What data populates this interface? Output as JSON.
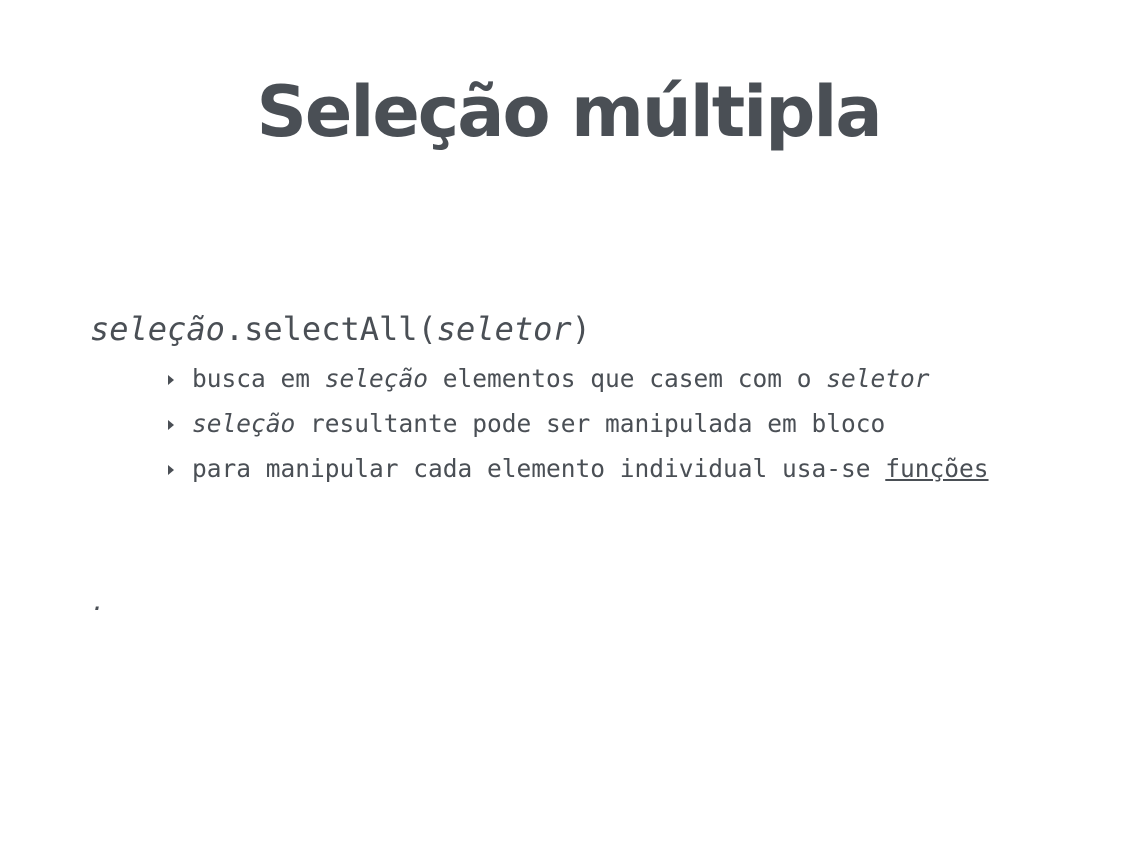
{
  "slide": {
    "title": "Seleção múltipla",
    "signature": {
      "object": "seleção",
      "method": ".selectAll(",
      "param": "seletor",
      "close": ")"
    },
    "bullets": [
      {
        "pre": "busca em ",
        "em1": "seleção",
        "mid": " elementos que casem com o ",
        "em2": "seletor"
      },
      {
        "em1": "seleção",
        "rest": " resultante pode ser manipulada em bloco"
      },
      {
        "pre": "para manipular cada elemento individual usa-se ",
        "link": "funções"
      }
    ],
    "trailing_dot": "."
  },
  "colors": {
    "text": "#4a4f55",
    "background": "#ffffff"
  }
}
